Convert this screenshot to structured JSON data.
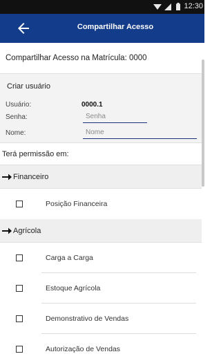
{
  "status_bar": {
    "time": "12:30"
  },
  "app_bar": {
    "title": "Compartilhar Acesso"
  },
  "heading": "Compartilhar Acesso na Matrícula: 0000",
  "create_user": {
    "title": "Criar usuário",
    "user_label": "Usuário:",
    "user_value": "0000.1",
    "password_label": "Senha:",
    "password_placeholder": "Senha",
    "name_label": "Nome:",
    "name_placeholder": "Nome"
  },
  "permissions_heading": "Terá permissão em:",
  "sections": [
    {
      "title": "Financeiro",
      "items": [
        {
          "label": "Posição Financeira",
          "checked": false
        }
      ]
    },
    {
      "title": "Agrícola",
      "items": [
        {
          "label": "Carga a Carga",
          "checked": false
        },
        {
          "label": "Estoque Agrícola",
          "checked": false
        },
        {
          "label": "Demonstrativo de Vendas",
          "checked": false
        },
        {
          "label": "Autorização de Vendas",
          "checked": false
        }
      ]
    }
  ],
  "colors": {
    "app_bar": "#133c8a",
    "status_bar": "#111111",
    "input_underline": "#1a2f7a"
  },
  "icons": {
    "back": "arrow-left-icon",
    "section": "arrow-right-icon",
    "checkbox": "checkbox-unchecked-icon"
  }
}
